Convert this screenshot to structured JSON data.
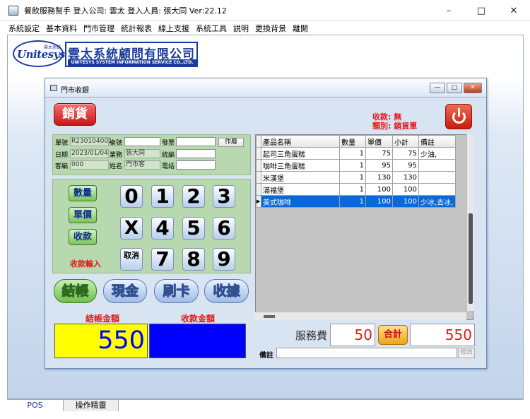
{
  "window": {
    "title": "餐飲服務幫手  登入公司: 雲太  登入人員: 張大同 Ver:22.12",
    "minimize": "–",
    "maximize": "□",
    "close": "✕"
  },
  "menu": [
    "系統設定",
    "基本資料",
    "門市管理",
    "統計報表",
    "線上支援",
    "系統工具",
    "説明",
    "更換背景",
    "離開"
  ],
  "logo": {
    "oval_text": "Unitesys",
    "oval_small": "雲太系統",
    "company_cn": "雲太系統顧問有限公司",
    "company_en": "UNITESYS SYSTEM INFORMATION SERVICE CO.,LTD."
  },
  "dialog": {
    "title": "門市收銀",
    "buttons": {
      "min": "—",
      "max": "□",
      "close": "✕"
    }
  },
  "sale_button": "銷貨",
  "status": {
    "payment": "收款: 無",
    "category": "類別: 銷貨單"
  },
  "info": {
    "order_no_label": "單號",
    "order_no": "R230104001",
    "table_label": "桌號",
    "table": "",
    "invoice_label": "發票",
    "invoice": "",
    "void_button": "作廢",
    "date_label": "日期",
    "date": "2023/01/04",
    "staff_label": "業務",
    "staff": "張大同",
    "taxid_label": "統編",
    "taxid": "",
    "customer_no_label": "客編",
    "customer_no": "000",
    "name_label": "姓名",
    "name": "門市客",
    "phone_label": "電話",
    "phone": ""
  },
  "keypad": {
    "qty": "數量",
    "price": "單價",
    "collect": "收款",
    "payment_input": "收款輸入",
    "keys": [
      "0",
      "1",
      "2",
      "3",
      "X",
      "4",
      "5",
      "6",
      "取消",
      "7",
      "8",
      "9"
    ]
  },
  "pay_buttons": [
    "結帳",
    "現金",
    "刷卡",
    "收據"
  ],
  "amounts": {
    "checkout_label": "結帳金額",
    "checkout_value": "550",
    "received_label": "收款金額",
    "received_value": ""
  },
  "grid": {
    "headers": [
      "產品名稱",
      "數量",
      "單價",
      "小計",
      "備註"
    ],
    "rows": [
      {
        "name": "起司三角蛋糕",
        "qty": "1",
        "price": "75",
        "subtotal": "75",
        "note": "少油,"
      },
      {
        "name": "咖啡三角蛋糕",
        "qty": "1",
        "price": "95",
        "subtotal": "95",
        "note": ""
      },
      {
        "name": "米漢堡",
        "qty": "1",
        "price": "130",
        "subtotal": "130",
        "note": ""
      },
      {
        "name": "滿福堡",
        "qty": "1",
        "price": "100",
        "subtotal": "100",
        "note": ""
      },
      {
        "name": "美式咖啡",
        "qty": "1",
        "price": "100",
        "subtotal": "100",
        "note": "少冰,去冰,"
      }
    ],
    "selected_indicator": "▶"
  },
  "service": {
    "label": "服務費",
    "value": "50",
    "total_button": "合計",
    "total_value": "550"
  },
  "note": {
    "label": "備註",
    "value": "",
    "edit_button": "修改"
  },
  "statusbar": {
    "pos": "POS",
    "wizard": "操作精靈"
  }
}
